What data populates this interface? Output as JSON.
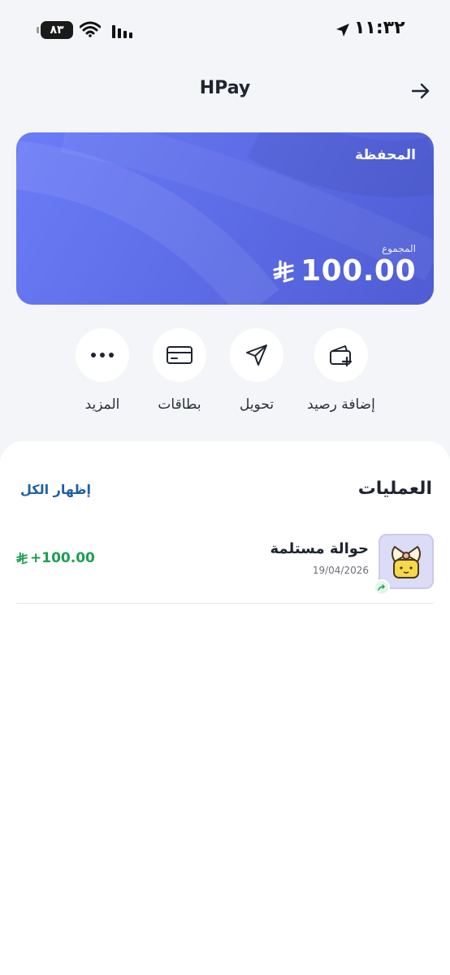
{
  "status_bar": {
    "time": "١١:٣٢",
    "battery": "٨٣"
  },
  "header": {
    "title": "HPay"
  },
  "wallet": {
    "title": "المحفظة",
    "total_label": "المجموع",
    "balance": "100.00"
  },
  "actions": [
    {
      "label": "إضافة رصيد",
      "icon": "wallet-add-icon"
    },
    {
      "label": "تحويل",
      "icon": "send-icon"
    },
    {
      "label": "بطاقات",
      "icon": "card-icon"
    },
    {
      "label": "المزيد",
      "icon": "more-icon"
    }
  ],
  "transactions": {
    "title": "العمليات",
    "show_all": "إظهار الكل",
    "items": [
      {
        "title": "حوالة مستلمة",
        "date": "19/04/2026",
        "amount": "+100.00"
      }
    ]
  },
  "colors": {
    "accent": "#5d6ee8",
    "positive": "#1e9e52",
    "link": "#1f5fa8"
  }
}
